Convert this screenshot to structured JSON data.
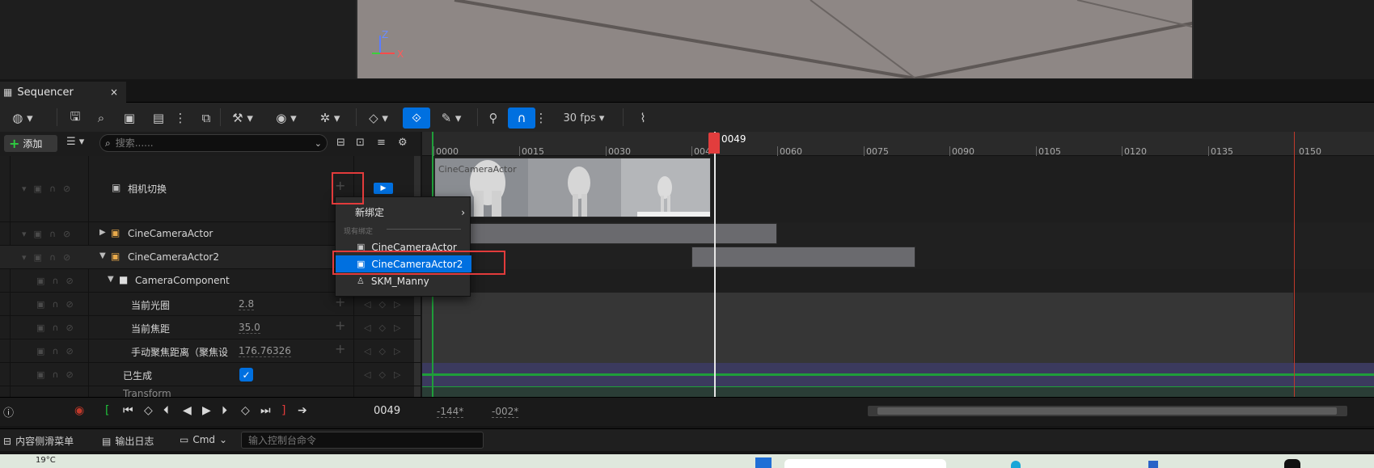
{
  "viewport": {
    "gizmo_z": "Z",
    "gizmo_x": "X"
  },
  "tab": {
    "label": "Sequencer",
    "close": "×"
  },
  "toolbar": {
    "fps": "30 fps"
  },
  "filter": {
    "add_label": "添加",
    "search_placeholder": "搜索......"
  },
  "tracks": {
    "camera_cuts": "相机切换",
    "actor1": "CineCameraActor",
    "actor2": "CineCameraActor2",
    "component": "CameraComponent",
    "prop_aperture": {
      "label": "当前光圈",
      "value": "2.8"
    },
    "prop_focal": {
      "label": "当前焦距",
      "value": "35.0"
    },
    "prop_focus": {
      "label": "手动聚焦距离（聚焦设",
      "value": "176.76326"
    },
    "spawned": "已生成",
    "transform": "Transform"
  },
  "context_menu": {
    "new_binding": "新绑定",
    "existing_caption": "现有绑定",
    "items": [
      "CineCameraActor",
      "CineCameraActor2",
      "SKM_Manny"
    ],
    "selected_index": 1
  },
  "timeline": {
    "ticks": [
      "0000",
      "0015",
      "0030",
      "004",
      "0060",
      "0075",
      "0090",
      "0105",
      "0120",
      "0135",
      "0150"
    ],
    "playhead": "0049",
    "shot_label": "CineCameraActor"
  },
  "transport": {
    "frame": "0049",
    "range_start": "-144*",
    "range_end": "-002*"
  },
  "statusbar": {
    "drawer": "内容侧滑菜单",
    "output_log": "输出日志",
    "cmd": "Cmd",
    "console_placeholder": "输入控制台命令"
  },
  "taskbar": {
    "weather": "19°C"
  },
  "colors": {
    "accent": "#0070e0",
    "playhead": "#e23d3d",
    "highlight_box": "#e23b3b"
  }
}
